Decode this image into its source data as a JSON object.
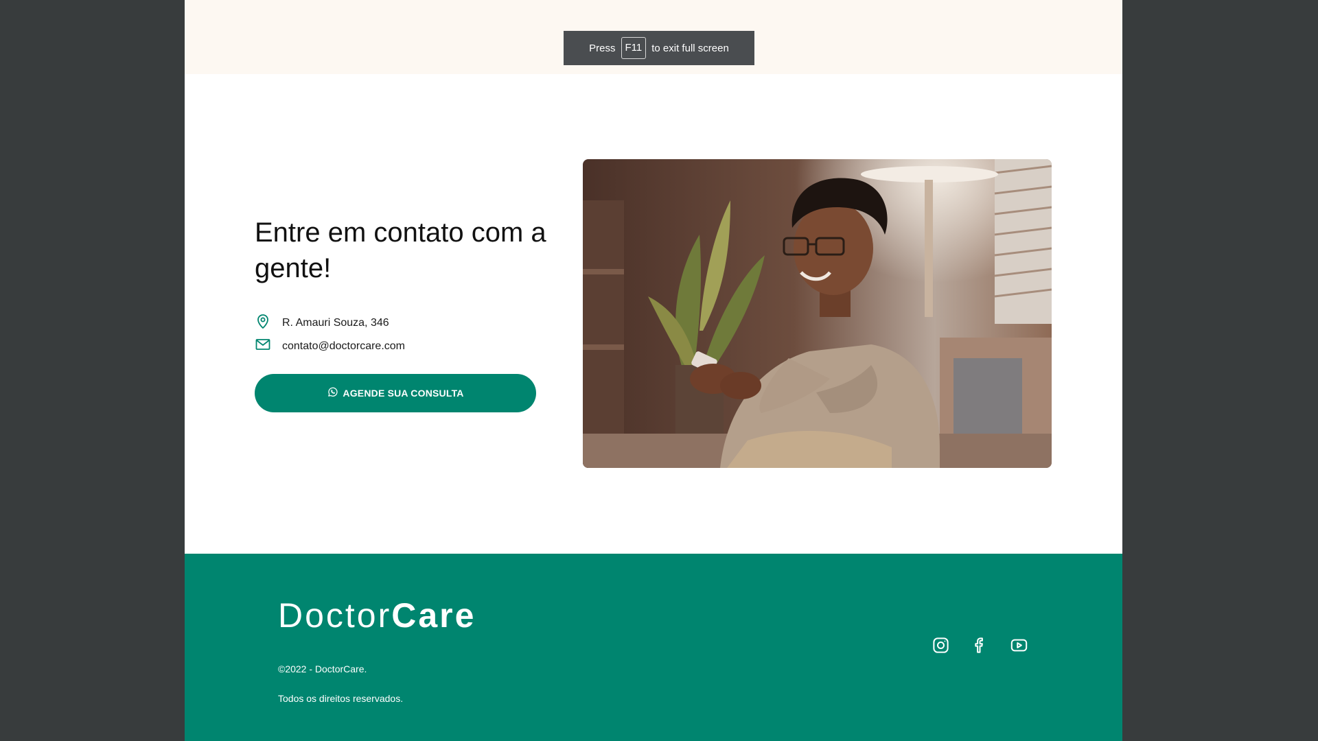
{
  "topbar": {
    "f11_press": "Press",
    "f11_key": "F11",
    "f11_suffix": "to exit full screen"
  },
  "contact": {
    "title": "Entre em contato com a gente!",
    "address": "R. Amauri Souza, 346",
    "email": "contato@doctorcare.com",
    "cta_label": "AGENDE SUA CONSULTA",
    "photo_description_icon": "person-with-phone-photo"
  },
  "footer": {
    "logo_regular": "Doctor",
    "logo_bold": "Care",
    "copyright": "©2022 - DoctorCare.",
    "rights": "Todos os direitos reservados.",
    "social_icons": [
      "instagram-icon",
      "facebook-icon",
      "youtube-icon"
    ]
  },
  "colors": {
    "brand": "#00856f",
    "topbar_bg": "#fdf8f2",
    "outer_bg": "#383c3d"
  }
}
